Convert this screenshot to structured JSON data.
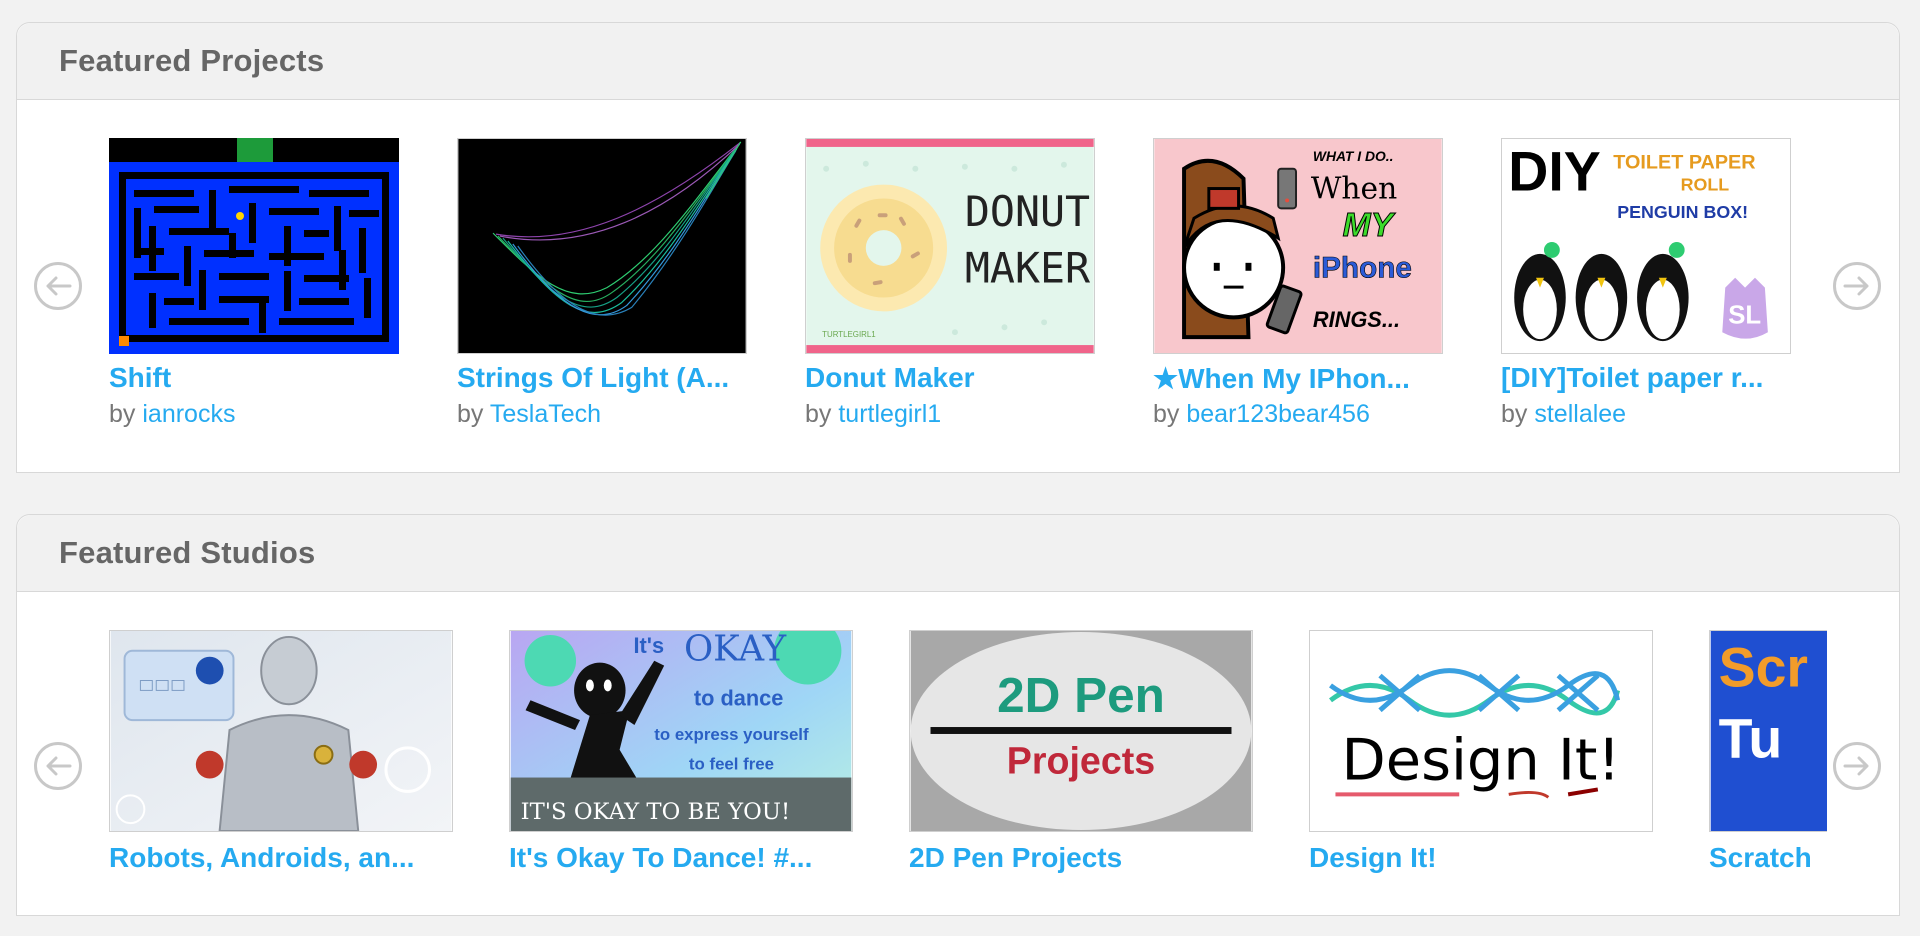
{
  "featured_projects": {
    "heading": "Featured Projects",
    "items": [
      {
        "title": "Shift",
        "by": "by",
        "author": "ianrocks"
      },
      {
        "title": "Strings Of Light (A...",
        "by": "by",
        "author": "TeslaTech"
      },
      {
        "title": "Donut Maker",
        "by": "by",
        "author": "turtlegirl1"
      },
      {
        "title": "★When My IPhon...",
        "by": "by",
        "author": "bear123bear456"
      },
      {
        "title": "[DIY]Toilet paper r...",
        "by": "by",
        "author": "stellalee"
      }
    ]
  },
  "featured_studios": {
    "heading": "Featured Studios",
    "items": [
      {
        "title": "Robots, Androids, an..."
      },
      {
        "title": "It's Okay To Dance! #..."
      },
      {
        "title": "2D Pen Projects"
      },
      {
        "title": "Design It!"
      },
      {
        "title": "Scratch"
      }
    ]
  },
  "thumb_text": {
    "donut_line1": "DONUT",
    "donut_line2": "MAKER",
    "donut_credit": "TURTLEGIRL1",
    "iphone_line1": "WHAT I DO..",
    "iphone_line2": "When",
    "iphone_line3": "MY",
    "iphone_line4": "iPhone",
    "iphone_line5": "RINGS...",
    "diy_big": "DIY",
    "diy_line1": "TOILET PAPER",
    "diy_line2": "ROLL",
    "diy_line3": "PENGUIN BOX!",
    "diy_badge": "SL",
    "dance_its": "It's",
    "dance_okay": "OKAY",
    "dance_line2": "to dance",
    "dance_line3": "to express yourself",
    "dance_line4": "to feel free",
    "dance_banner": "IT'S OKAY TO BE YOU!",
    "pen_line1": "2D Pen",
    "pen_line2": "Projects",
    "design_text": "Design It!",
    "scratch_line1": "Scr",
    "scratch_line2": "Tu"
  },
  "colors": {
    "link": "#25aaf0",
    "heading": "#666666",
    "header_bg": "#f1f1f1",
    "page_bg": "#f2f2f2"
  }
}
